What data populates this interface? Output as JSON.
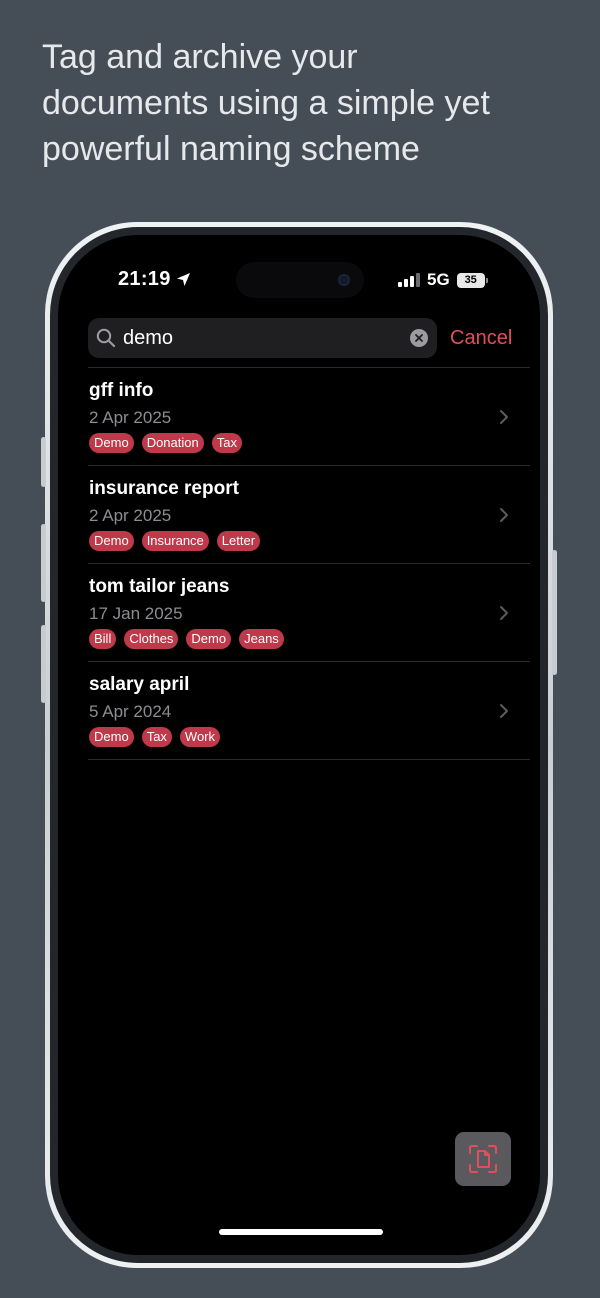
{
  "headline": {
    "line1": "Tag and archive your",
    "line2": "documents using a simple yet",
    "line3": "powerful naming scheme"
  },
  "status_bar": {
    "time": "21:19",
    "network": "5G",
    "battery": "35"
  },
  "search": {
    "value": "demo",
    "cancel_label": "Cancel"
  },
  "documents": [
    {
      "title": "gff info",
      "date": "2 Apr 2025",
      "tags": [
        "Demo",
        "Donation",
        "Tax"
      ]
    },
    {
      "title": "insurance report",
      "date": "2 Apr 2025",
      "tags": [
        "Demo",
        "Insurance",
        "Letter"
      ]
    },
    {
      "title": "tom tailor jeans",
      "date": "17 Jan 2025",
      "tags": [
        "Bill",
        "Clothes",
        "Demo",
        "Jeans"
      ]
    },
    {
      "title": "salary april",
      "date": "5 Apr 2024",
      "tags": [
        "Demo",
        "Tax",
        "Work"
      ]
    }
  ],
  "colors": {
    "accent": "#e0505a",
    "tag_background": "#c0394a",
    "page_background": "#454e57"
  },
  "icons": {
    "fab": "document-scan-icon",
    "row": "chevron-right-icon",
    "search": "search-icon",
    "clear": "clear-icon"
  }
}
